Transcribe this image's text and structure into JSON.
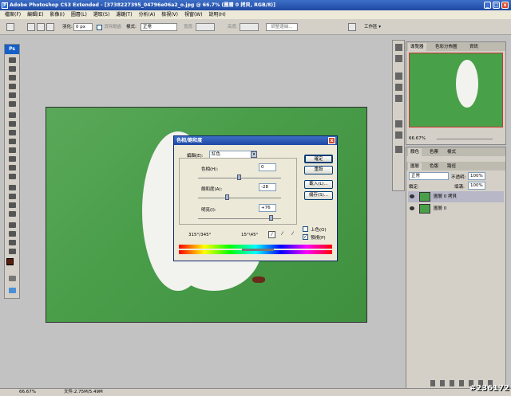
{
  "window": {
    "title": "Adobe Photoshop CS3 Extended - [3738227395_04796e06a2_o.jpg @ 66.7% (圖層 0 拷貝, RGB/8)]",
    "minimize_label": "_",
    "maximize_label": "□",
    "close_label": "x"
  },
  "menu": [
    "檔案(F)",
    "編輯(E)",
    "影像(I)",
    "圖層(L)",
    "選取(S)",
    "濾鏡(T)",
    "分析(A)",
    "檢視(V)",
    "視窗(W)",
    "說明(H)"
  ],
  "options": {
    "feather_label": "羽化:",
    "feather_value": "0 px",
    "antialias_label": "消除鋸齒",
    "style_label": "樣式:",
    "style_value": "正常",
    "width_label": "寬度:",
    "height_label": "高度:",
    "refine_label": "調整邊緣...",
    "workspace_label": "工作區 ▾"
  },
  "toolbox": {
    "logo": "Ps"
  },
  "dialog": {
    "title": "色相/飽和度",
    "close_label": "x",
    "edit_label": "編輯(E):",
    "edit_value": "紅色",
    "hue_label": "色相(H):",
    "hue_value": "0",
    "hue": 0,
    "saturation_label": "飽和度(A):",
    "saturation_value": "-28",
    "saturation": -28,
    "lightness_label": "明亮(I):",
    "lightness_value": "+76",
    "lightness": 76,
    "ok_label": "確定",
    "reset_label": "重設",
    "load_label": "載入(L)...",
    "save_label": "儲存(S)...",
    "colorize_label": "上色(O)",
    "colorize": false,
    "preview_label": "預視(P)",
    "preview": true,
    "range_left": "315°/345°",
    "range_right": "15°\\45°"
  },
  "navigator": {
    "tabs": [
      "導覽器",
      "色彩分佈圖",
      "資訊"
    ],
    "zoom": "66.67%"
  },
  "layers_panel": {
    "tabs": [
      "圖層",
      "色版",
      "路徑"
    ],
    "color_tabs": [
      "顏色",
      "色票",
      "樣式"
    ],
    "blend_mode": "正常",
    "opacity_label": "不透明:",
    "opacity_value": "100%",
    "lock_label": "鎖定:",
    "fill_label": "填滿:",
    "fill_value": "100%",
    "layers": [
      {
        "name": "圖層 0 拷貝",
        "selected": true
      },
      {
        "name": "圖層 0",
        "selected": false
      }
    ]
  },
  "status": {
    "zoom": "66.67%",
    "doc": "文件:2.75M/5.49M"
  },
  "watermark": "#236172"
}
